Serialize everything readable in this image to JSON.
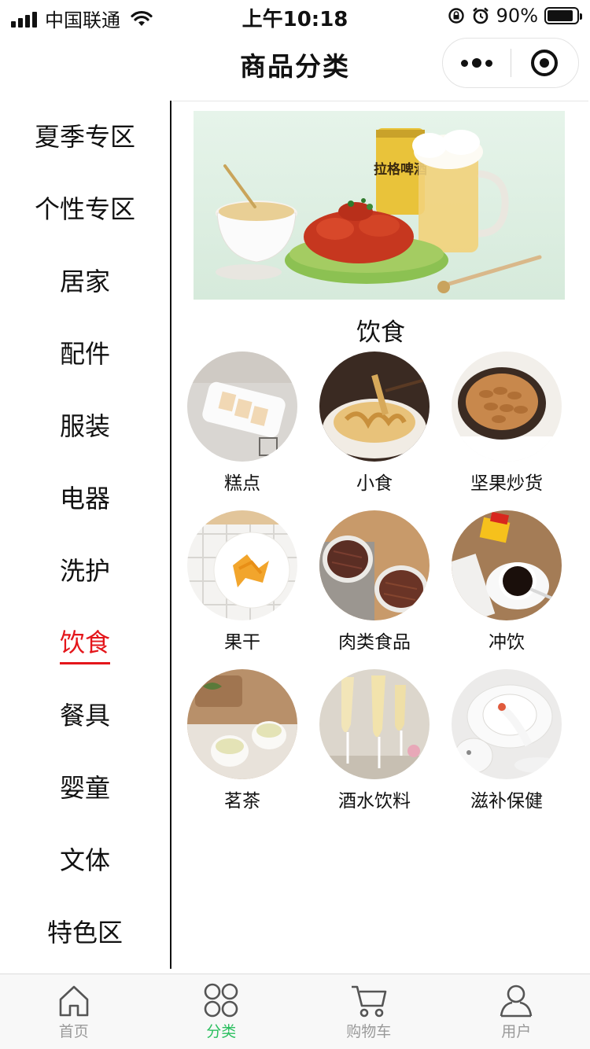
{
  "status_bar": {
    "carrier": "中国联通",
    "time": "上午10:18",
    "battery": "90%",
    "battery_level": 0.9
  },
  "nav": {
    "title": "商品分类"
  },
  "sidebar": {
    "active_index": 7,
    "items": [
      {
        "label": "夏季专区"
      },
      {
        "label": "个性专区"
      },
      {
        "label": "居家"
      },
      {
        "label": "配件"
      },
      {
        "label": "服装"
      },
      {
        "label": "电器"
      },
      {
        "label": "洗护"
      },
      {
        "label": "饮食"
      },
      {
        "label": "餐具"
      },
      {
        "label": "婴童"
      },
      {
        "label": "文体"
      },
      {
        "label": "特色区"
      }
    ]
  },
  "content": {
    "banner_text": "拉格啤酒",
    "section_title": "饮食",
    "categories": [
      {
        "label": "糕点"
      },
      {
        "label": "小食"
      },
      {
        "label": "坚果炒货"
      },
      {
        "label": "果干"
      },
      {
        "label": "肉类食品"
      },
      {
        "label": "冲饮"
      },
      {
        "label": "茗茶"
      },
      {
        "label": "酒水饮料"
      },
      {
        "label": "滋补保健"
      }
    ]
  },
  "tab_bar": {
    "active_index": 1,
    "tabs": [
      {
        "label": "首页",
        "icon": "home-icon"
      },
      {
        "label": "分类",
        "icon": "category-icon"
      },
      {
        "label": "购物车",
        "icon": "cart-icon"
      },
      {
        "label": "用户",
        "icon": "user-icon"
      }
    ]
  },
  "colors": {
    "accent_red": "#e4161b",
    "tab_active_green": "#2bbf5f",
    "tab_inactive": "#9a9a9a"
  }
}
